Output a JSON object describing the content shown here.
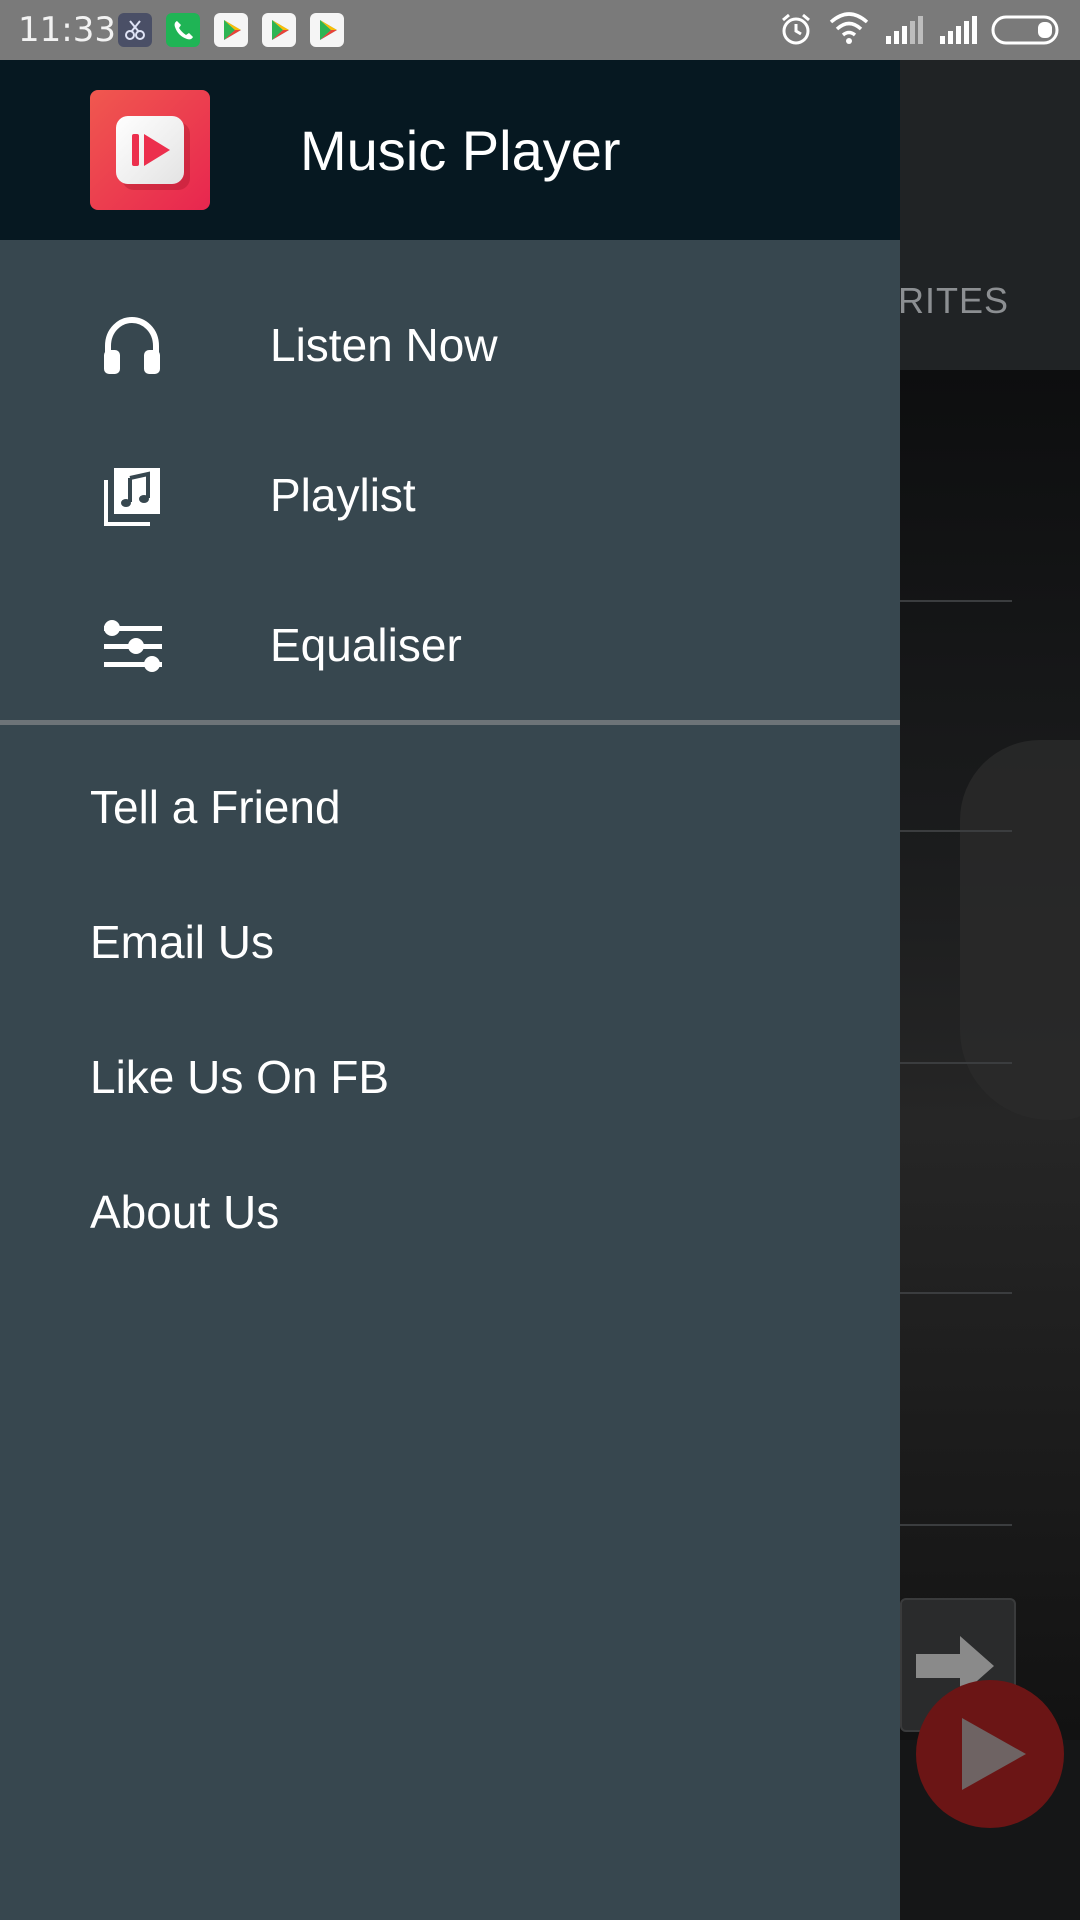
{
  "status_bar": {
    "time": "11:33",
    "notification_icons": [
      "scissors-app-icon",
      "phone-icon",
      "play-store-icon",
      "play-store-icon",
      "play-store-icon"
    ],
    "system_icons": [
      "alarm-icon",
      "wifi-icon",
      "signal-icon",
      "signal-icon",
      "battery-icon"
    ]
  },
  "drawer": {
    "header": {
      "app_title": "Music Player",
      "logo_colors": [
        "#f0584f",
        "#e8264f"
      ]
    },
    "primary_items": [
      {
        "label": "Listen Now",
        "icon": "headphones-icon"
      },
      {
        "label": "Playlist",
        "icon": "music-library-icon"
      },
      {
        "label": "Equaliser",
        "icon": "equaliser-icon"
      }
    ],
    "secondary_items": [
      {
        "label": "Tell a Friend"
      },
      {
        "label": "Email Us"
      },
      {
        "label": "Like Us On FB"
      },
      {
        "label": "About Us"
      }
    ],
    "colors": {
      "header_bg": "#061821",
      "drawer_bg": "#37474f",
      "divider": "#6d7478"
    }
  },
  "background": {
    "tab_label_partial": "RITES",
    "fab_icon": "play-icon"
  }
}
